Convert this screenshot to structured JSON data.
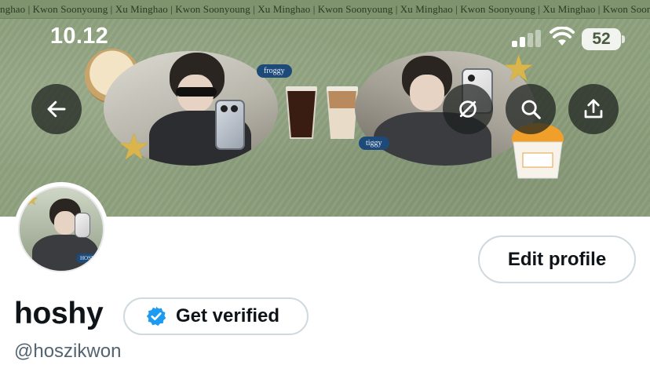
{
  "banner": {
    "ticker_text": "nghao | Kwon Soonyoung | Xu Minghao | Kwon Soonyoung | Xu Minghao | Kwon Soonyoung | Xu Minghao | Kwon Soonyoung | Xu Minghao | Kwon Soonyoung | Xu Minghao | Kwo",
    "tag_left": "froggy",
    "tag_right": "tiggy",
    "avatar_tag": "HOSHI"
  },
  "status_bar": {
    "time": "10.12",
    "battery": "52"
  },
  "nav": {
    "back_icon": "arrow-left-icon",
    "hide_icon": "eye-off-icon",
    "search_icon": "search-icon",
    "share_icon": "share-icon"
  },
  "profile": {
    "edit_label": "Edit profile",
    "display_name": "hoshy",
    "verify_label": "Get verified",
    "handle": "@hoszikwon"
  },
  "colors": {
    "banner_green": "#8fa27f",
    "verified_blue": "#1d9bf0",
    "handle_gray": "#536471",
    "button_border": "#cfd9de"
  }
}
